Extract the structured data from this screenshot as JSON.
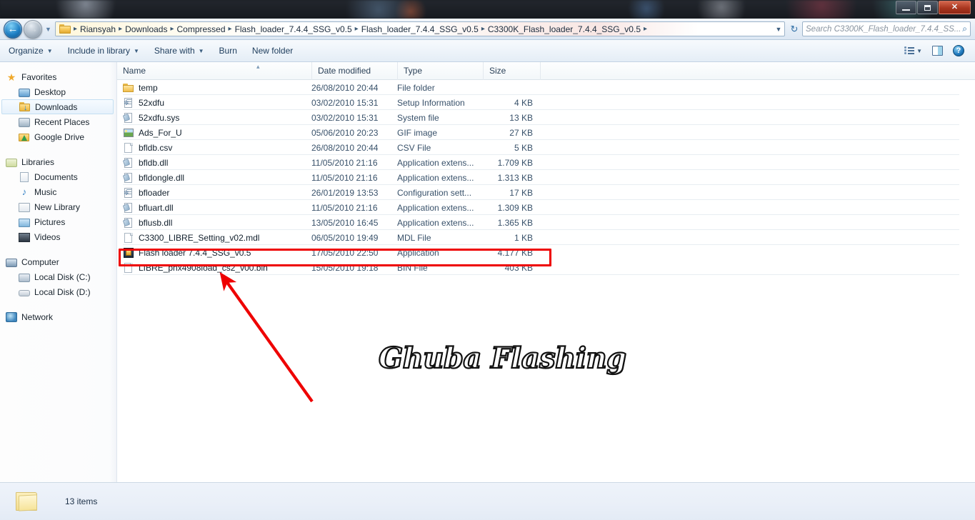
{
  "window": {
    "minimize_label": "Minimize",
    "restore_label": "Restore",
    "close_label": "✕"
  },
  "nav": {
    "back_glyph": "←",
    "forward_glyph": "→",
    "history_caret": "▼",
    "address_dropdown": "▼",
    "refresh_glyph": "↻",
    "breadcrumbs": [
      "Riansyah",
      "Downloads",
      "Compressed",
      "Flash_loader_7.4.4_SSG_v0.5",
      "Flash_loader_7.4.4_SSG_v0.5",
      "C3300K_Flash_loader_7.4.4_SSG_v0.5"
    ],
    "separator": "▸",
    "search_placeholder": "Search C3300K_Flash_loader_7.4.4_SS...",
    "search_value": "",
    "search_icon": "⌕"
  },
  "toolbar": {
    "items": [
      {
        "label": "Organize",
        "has_caret": true
      },
      {
        "label": "Include in library",
        "has_caret": true
      },
      {
        "label": "Share with",
        "has_caret": true
      },
      {
        "label": "Burn",
        "has_caret": false
      },
      {
        "label": "New folder",
        "has_caret": false
      }
    ],
    "view_caret": "▼",
    "help_label": "?"
  },
  "sidebar": {
    "groups": [
      {
        "header": {
          "label": "Favorites",
          "icon": "star-icon"
        },
        "items": [
          {
            "label": "Desktop",
            "icon": "desktop-icon",
            "selected": false
          },
          {
            "label": "Downloads",
            "icon": "downloads-folder-icon",
            "selected": true
          },
          {
            "label": "Recent Places",
            "icon": "recent-places-icon",
            "selected": false
          },
          {
            "label": "Google Drive",
            "icon": "google-drive-icon",
            "selected": false
          }
        ]
      },
      {
        "header": {
          "label": "Libraries",
          "icon": "libraries-icon"
        },
        "items": [
          {
            "label": "Documents",
            "icon": "documents-icon",
            "selected": false
          },
          {
            "label": "Music",
            "icon": "music-icon",
            "selected": false
          },
          {
            "label": "New Library",
            "icon": "new-library-icon",
            "selected": false
          },
          {
            "label": "Pictures",
            "icon": "pictures-icon",
            "selected": false
          },
          {
            "label": "Videos",
            "icon": "videos-icon",
            "selected": false
          }
        ]
      },
      {
        "header": {
          "label": "Computer",
          "icon": "computer-icon"
        },
        "items": [
          {
            "label": "Local Disk (C:)",
            "icon": "local-disk-c-icon",
            "selected": false
          },
          {
            "label": "Local Disk (D:)",
            "icon": "local-disk-d-icon",
            "selected": false
          }
        ]
      },
      {
        "header": {
          "label": "Network",
          "icon": "network-icon"
        },
        "items": []
      }
    ]
  },
  "filelist": {
    "columns": [
      {
        "label": "Name",
        "sorted": true
      },
      {
        "label": "Date modified",
        "sorted": false
      },
      {
        "label": "Type",
        "sorted": false
      },
      {
        "label": "Size",
        "sorted": false
      }
    ],
    "sort_caret": "▴",
    "rows": [
      {
        "name": "temp",
        "date": "26/08/2010 20:44",
        "type": "File folder",
        "size": "",
        "icon": "folder-icon",
        "highlighted": false
      },
      {
        "name": "52xdfu",
        "date": "03/02/2010 15:31",
        "type": "Setup Information",
        "size": "4 KB",
        "icon": "setup-information-icon",
        "highlighted": false
      },
      {
        "name": "52xdfu.sys",
        "date": "03/02/2010 15:31",
        "type": "System file",
        "size": "13 KB",
        "icon": "system-file-icon",
        "highlighted": false
      },
      {
        "name": "Ads_For_U",
        "date": "05/06/2010 20:23",
        "type": "GIF image",
        "size": "27 KB",
        "icon": "gif-image-icon",
        "highlighted": false
      },
      {
        "name": "bfldb.csv",
        "date": "26/08/2010 20:44",
        "type": "CSV File",
        "size": "5 KB",
        "icon": "generic-file-icon",
        "highlighted": false
      },
      {
        "name": "bfldb.dll",
        "date": "11/05/2010 21:16",
        "type": "Application extens...",
        "size": "1.709 KB",
        "icon": "system-file-icon",
        "highlighted": false
      },
      {
        "name": "bfldongle.dll",
        "date": "11/05/2010 21:16",
        "type": "Application extens...",
        "size": "1.313 KB",
        "icon": "system-file-icon",
        "highlighted": false
      },
      {
        "name": "bfloader",
        "date": "26/01/2019 13:53",
        "type": "Configuration sett...",
        "size": "17 KB",
        "icon": "setup-information-icon",
        "highlighted": false
      },
      {
        "name": "bfluart.dll",
        "date": "11/05/2010 21:16",
        "type": "Application extens...",
        "size": "1.309 KB",
        "icon": "system-file-icon",
        "highlighted": false
      },
      {
        "name": "bflusb.dll",
        "date": "13/05/2010 16:45",
        "type": "Application extens...",
        "size": "1.365 KB",
        "icon": "system-file-icon",
        "highlighted": false
      },
      {
        "name": "C3300_LIBRE_Setting_v02.mdl",
        "date": "06/05/2010 19:49",
        "type": "MDL File",
        "size": "1 KB",
        "icon": "generic-file-icon",
        "highlighted": false
      },
      {
        "name": "Flash loader 7.4.4_SSG_v0.5",
        "date": "17/05/2010 22:50",
        "type": "Application",
        "size": "4.177 KB",
        "icon": "application-icon",
        "highlighted": true
      },
      {
        "name": "LIBRE_pnx4908load_cs2_v00.bin",
        "date": "15/05/2010 19:18",
        "type": "BIN File",
        "size": "403 KB",
        "icon": "generic-file-icon",
        "highlighted": false
      }
    ]
  },
  "annotation": {
    "color": "#ee0000",
    "watermark_text": "Ghuba Flashing"
  },
  "statusbar": {
    "item_count": "13 items"
  }
}
